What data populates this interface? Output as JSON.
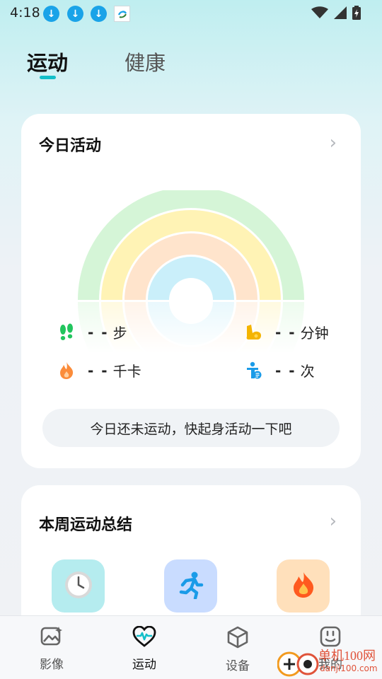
{
  "status_bar": {
    "time": "4:18"
  },
  "tabs": [
    {
      "label": "运动",
      "active": true
    },
    {
      "label": "健康",
      "active": false
    }
  ],
  "activity_card": {
    "title": "今日活动",
    "stats": {
      "steps": {
        "value": "- -",
        "unit": "步",
        "icon": "footprints-icon",
        "color": "#22c55e"
      },
      "minutes": {
        "value": "- -",
        "unit": "分钟",
        "icon": "flexed-arm-icon",
        "color": "#f4b400"
      },
      "calories": {
        "value": "- -",
        "unit": "千卡",
        "icon": "flame-icon",
        "color": "#fb8c3a"
      },
      "times": {
        "value": "- -",
        "unit": "次",
        "icon": "person-activity-icon",
        "color": "#1a9be8"
      }
    },
    "ring_colors": [
      "#d5f5d7",
      "#fff3b5",
      "#ffe4cc",
      "#caeffa"
    ],
    "hint": "今日还未运动，快起身活动一下吧"
  },
  "weekly_card": {
    "title": "本周运动总结",
    "tiles": [
      {
        "icon": "clock-icon",
        "bg": "#b5ecef"
      },
      {
        "icon": "running-icon",
        "bg": "#c9dcff"
      },
      {
        "icon": "flame-icon",
        "bg": "#ffe0bb"
      }
    ]
  },
  "bottom_nav": [
    {
      "label": "影像",
      "icon": "image-icon",
      "active": false
    },
    {
      "label": "运动",
      "icon": "heart-pulse-icon",
      "active": true
    },
    {
      "label": "设备",
      "icon": "cube-icon",
      "active": false
    },
    {
      "label": "我的",
      "icon": "smile-icon",
      "active": false
    }
  ],
  "watermark": {
    "text": "单机100网",
    "url": "danji100.com"
  }
}
